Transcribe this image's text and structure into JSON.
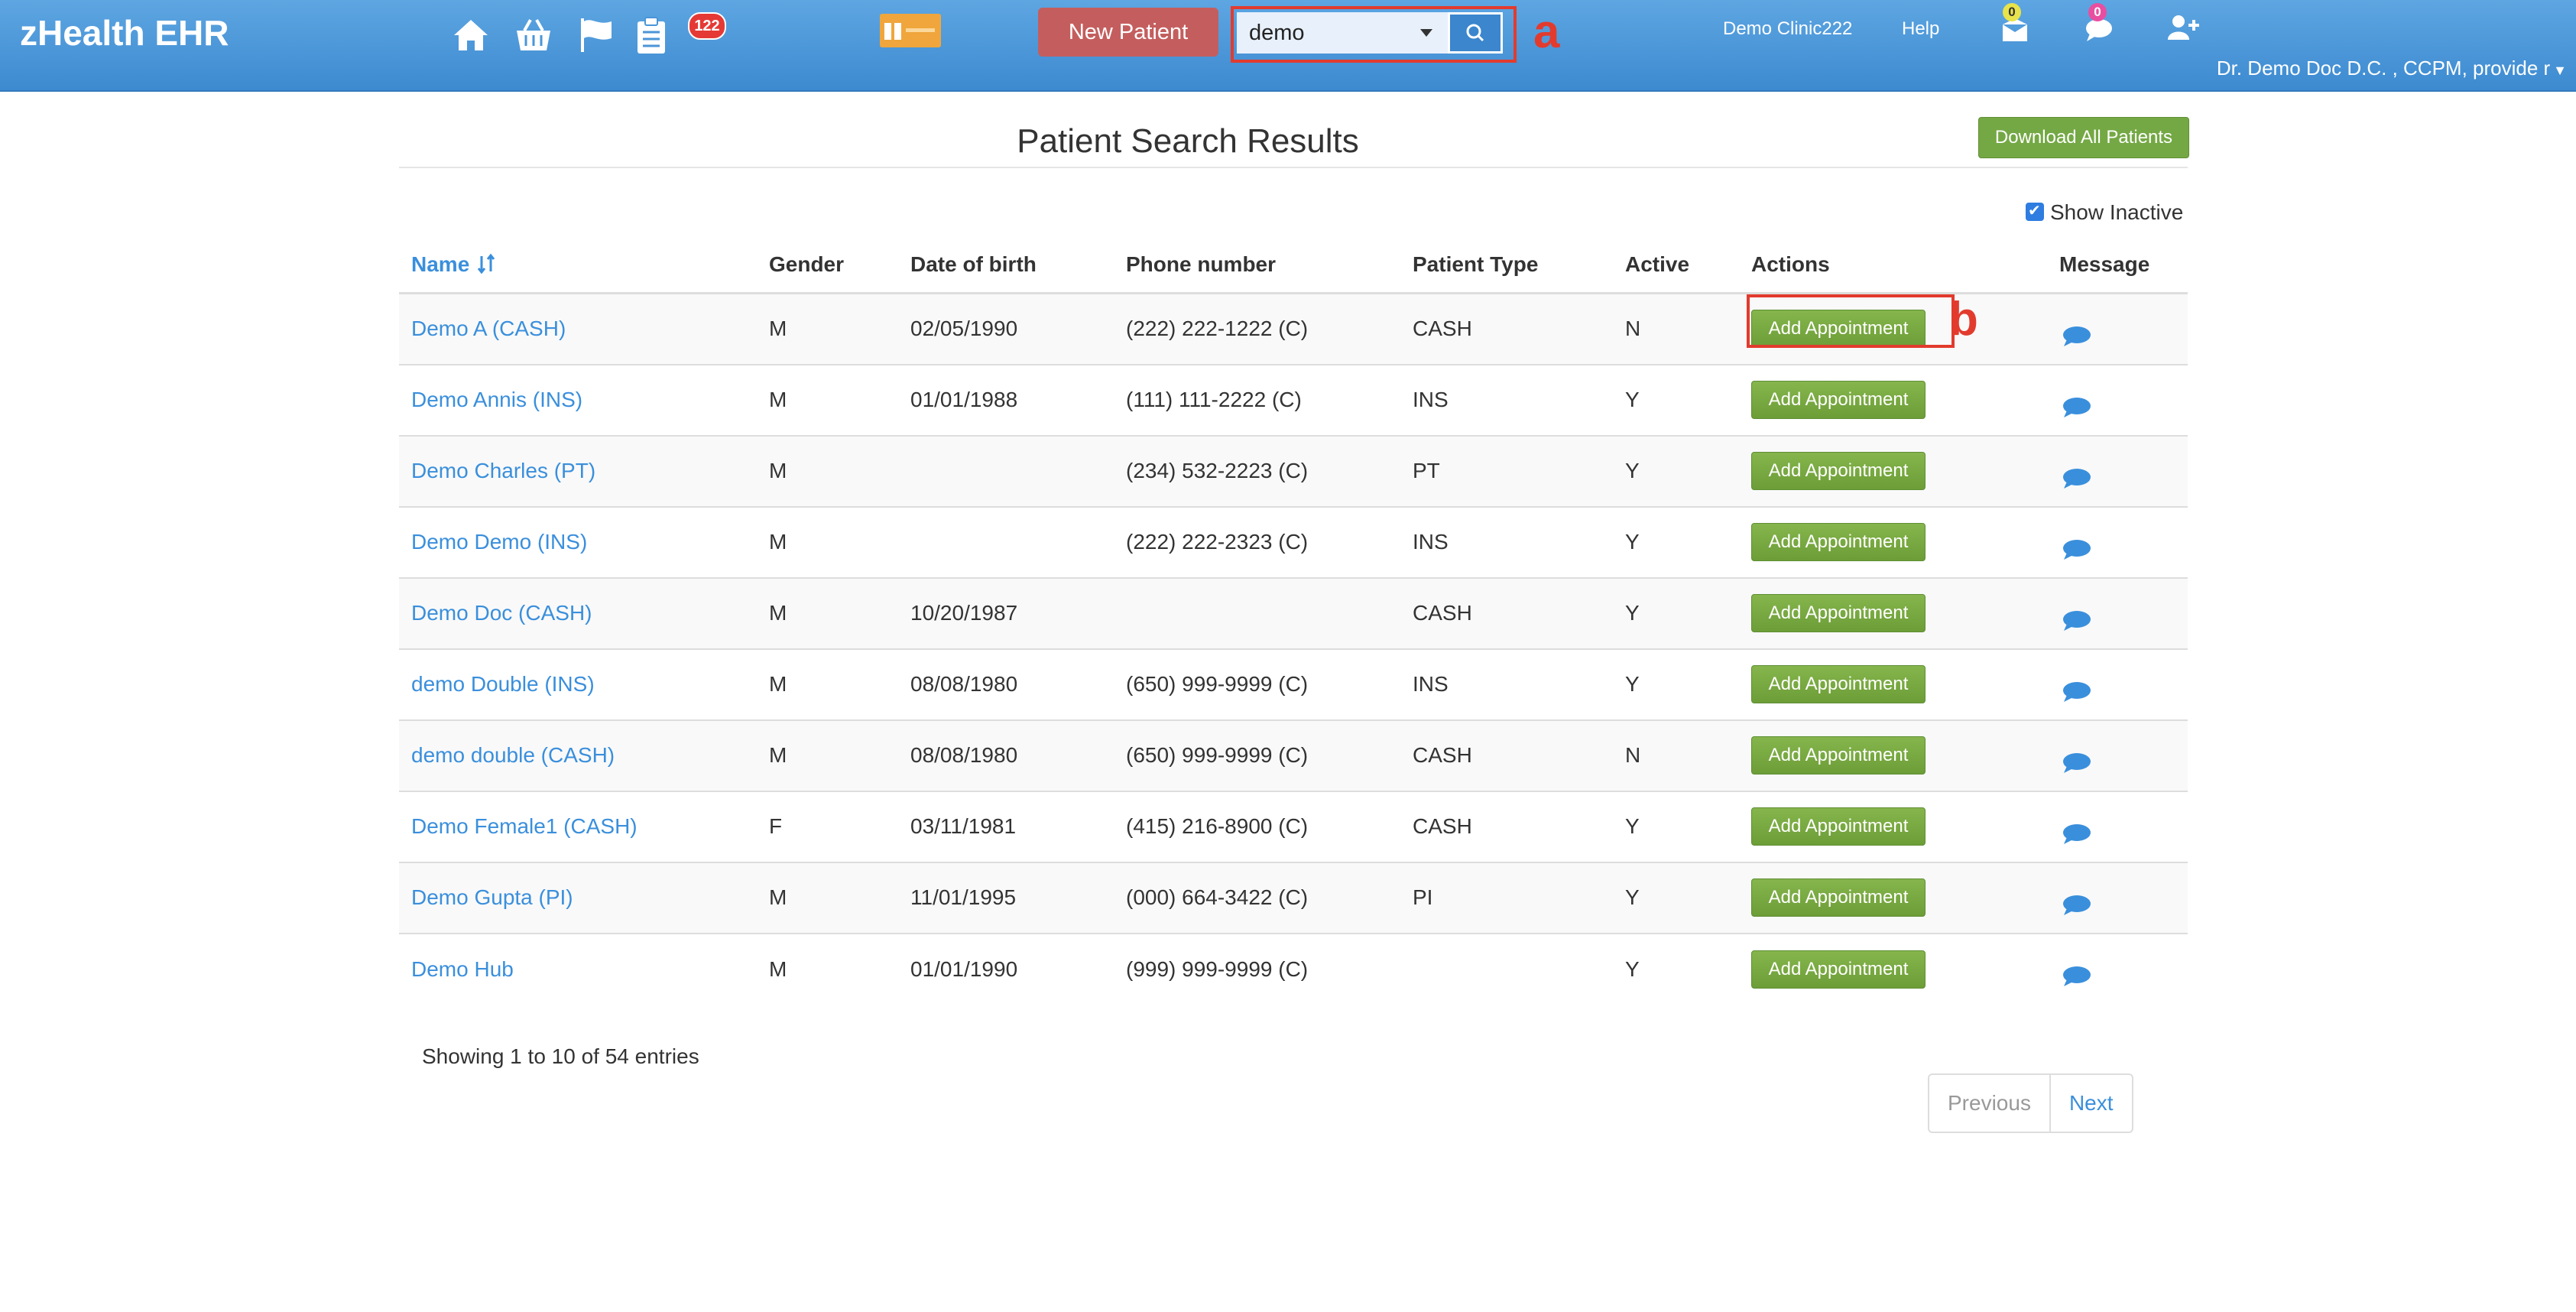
{
  "header": {
    "brand": "zHealth EHR",
    "nav_icons": [
      "home-icon",
      "basket-icon",
      "flag-icon",
      "clipboard-icon"
    ],
    "tasks_badge": "122",
    "new_patient_label": "New Patient",
    "search": {
      "value": "demo"
    },
    "annotation_a": "a",
    "clinic_name": "Demo Clinic222",
    "help_label": "Help",
    "mail_count": "0",
    "chat_count": "0",
    "user_name": "Dr. Demo Doc D.C. , CCPM, provide r",
    "colors": {
      "bar": "#4a95d8",
      "new_patient": "#c45e5e",
      "search_button": "#3b86cd",
      "annotation": "#e23b2e"
    }
  },
  "main": {
    "title": "Patient Search Results",
    "download_label": "Download All Patients",
    "show_inactive_label": "Show Inactive",
    "show_inactive_checked": true,
    "columns": {
      "name": "Name",
      "gender": "Gender",
      "dob": "Date of birth",
      "phone": "Phone number",
      "type": "Patient Type",
      "active": "Active",
      "actions": "Actions",
      "message": "Message"
    },
    "action_label": "Add Appointment",
    "annotation_b": "b",
    "rows": [
      {
        "name": "Demo A  (CASH)",
        "gender": "M",
        "dob": "02/05/1990",
        "phone": "(222) 222-1222 (C)",
        "type": "CASH",
        "active": "N"
      },
      {
        "name": "Demo Annis  (INS)",
        "gender": "M",
        "dob": "01/01/1988",
        "phone": "(111) 111-2222 (C)",
        "type": "INS",
        "active": "Y"
      },
      {
        "name": "Demo Charles  (PT)",
        "gender": "M",
        "dob": "",
        "phone": "(234) 532-2223 (C)",
        "type": "PT",
        "active": "Y"
      },
      {
        "name": "Demo Demo  (INS)",
        "gender": "M",
        "dob": "",
        "phone": "(222) 222-2323 (C)",
        "type": "INS",
        "active": "Y"
      },
      {
        "name": "Demo Doc  (CASH)",
        "gender": "M",
        "dob": "10/20/1987",
        "phone": "",
        "type": "CASH",
        "active": "Y"
      },
      {
        "name": "demo Double  (INS)",
        "gender": "M",
        "dob": "08/08/1980",
        "phone": "(650) 999-9999 (C)",
        "type": "INS",
        "active": "Y"
      },
      {
        "name": "demo double  (CASH)",
        "gender": "M",
        "dob": "08/08/1980",
        "phone": "(650) 999-9999 (C)",
        "type": "CASH",
        "active": "N"
      },
      {
        "name": "Demo Female1  (CASH)",
        "gender": "F",
        "dob": "03/11/1981",
        "phone": "(415) 216-8900 (C)",
        "type": "CASH",
        "active": "Y"
      },
      {
        "name": "Demo Gupta  (PI)",
        "gender": "M",
        "dob": "11/01/1995",
        "phone": "(000) 664-3422 (C)",
        "type": "PI",
        "active": "Y"
      },
      {
        "name": "Demo Hub",
        "gender": "M",
        "dob": "01/01/1990",
        "phone": "(999) 999-9999 (C)",
        "type": "",
        "active": "Y"
      }
    ],
    "showing_text": "Showing 1 to 10 of 54 entries",
    "pager": {
      "previous": "Previous",
      "next": "Next"
    },
    "colors": {
      "link": "#3a8fdc",
      "action_button": "#74a844"
    }
  }
}
